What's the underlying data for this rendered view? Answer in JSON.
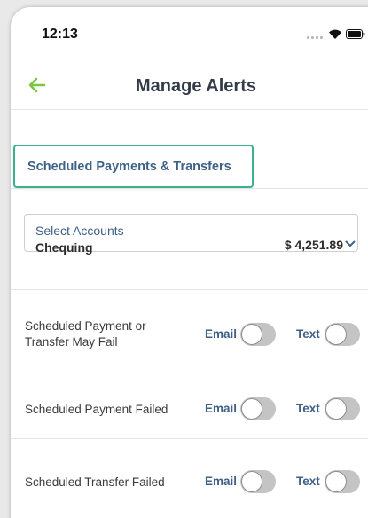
{
  "status_bar": {
    "time": "12:13"
  },
  "header": {
    "title": "Manage Alerts"
  },
  "section": {
    "label": "Scheduled Payments & Transfers"
  },
  "account": {
    "label": "Select Accounts",
    "name": "Chequing",
    "balance": "$ 4,251.89"
  },
  "alerts": [
    {
      "label": "Scheduled Payment or Transfer May Fail",
      "email_label": "Email",
      "text_label": "Text",
      "email_on": false,
      "text_on": false
    },
    {
      "label": "Scheduled Payment Failed",
      "email_label": "Email",
      "text_label": "Text",
      "email_on": false,
      "text_on": false
    },
    {
      "label": "Scheduled Transfer Failed",
      "email_label": "Email",
      "text_label": "Text",
      "email_on": false,
      "text_on": false
    }
  ],
  "colors": {
    "accent_green": "#3bb08f",
    "link_blue": "#3f6188",
    "back_arrow": "#7cc644"
  }
}
